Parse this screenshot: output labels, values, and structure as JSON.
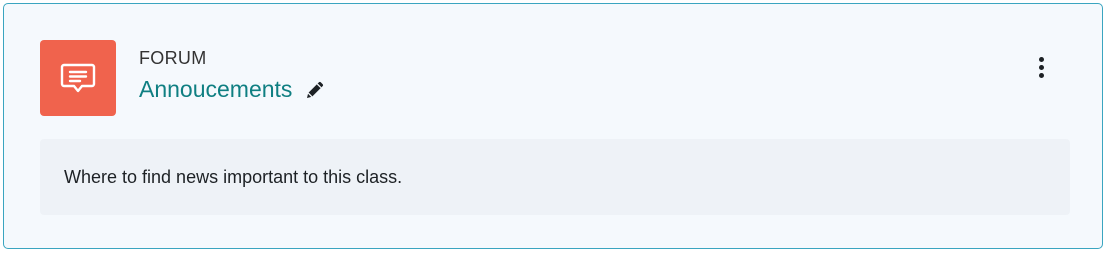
{
  "activity": {
    "type_label": "FORUM",
    "title": "Annoucements",
    "description": "Where to find news important to this class.",
    "icon": "forum-speech-bubble-icon",
    "icon_bg_color": "#f0634d",
    "title_color": "#0f7f82",
    "border_color": "#3aa5c0"
  },
  "actions": {
    "edit_icon": "pencil-icon",
    "menu_icon": "vertical-ellipsis-icon"
  }
}
